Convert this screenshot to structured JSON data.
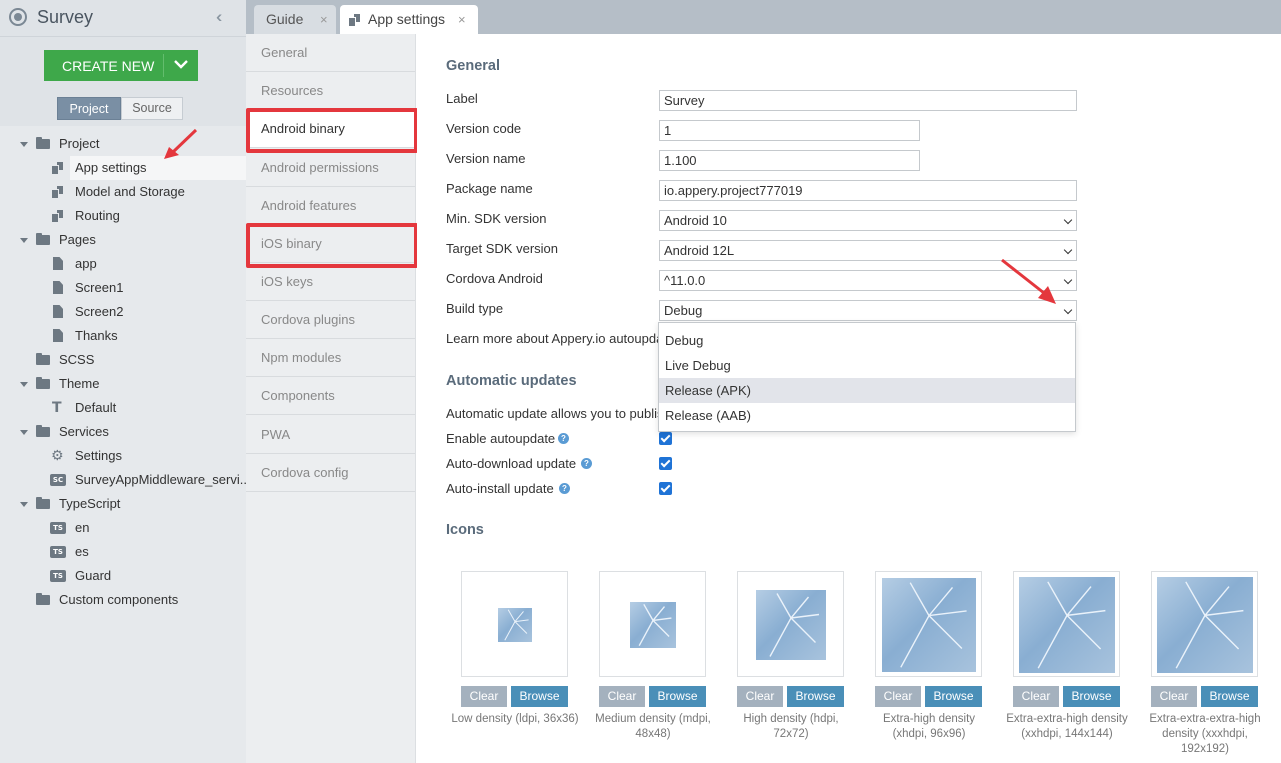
{
  "app": {
    "title": "Survey"
  },
  "create_new": {
    "label": "CREATE NEW"
  },
  "segments": {
    "project": "Project",
    "source": "Source"
  },
  "tree": {
    "project": "Project",
    "app_settings": "App settings",
    "model_storage": "Model and Storage",
    "routing": "Routing",
    "pages": "Pages",
    "app": "app",
    "screen1": "Screen1",
    "screen2": "Screen2",
    "thanks": "Thanks",
    "scss": "SCSS",
    "theme": "Theme",
    "default": "Default",
    "services": "Services",
    "settings": "Settings",
    "middleware": "SurveyAppMiddleware_servi...",
    "typescript": "TypeScript",
    "en": "en",
    "es": "es",
    "guard": "Guard",
    "custom_components": "Custom components",
    "badge_sc": "SC",
    "badge_ts": "TS"
  },
  "tabs": {
    "guide": "Guide",
    "app_settings": "App settings",
    "close": "×"
  },
  "nav": [
    "General",
    "Resources",
    "Android binary",
    "Android permissions",
    "Android features",
    "iOS binary",
    "iOS keys",
    "Cordova plugins",
    "Npm modules",
    "Components",
    "PWA",
    "Cordova config"
  ],
  "general": {
    "title": "General",
    "label_label": "Label",
    "label_value": "Survey",
    "version_code_label": "Version code",
    "version_code_value": "1",
    "version_name_label": "Version name",
    "version_name_value": "1.100",
    "package_label": "Package name",
    "package_value": "io.appery.project777019",
    "min_sdk_label": "Min. SDK version",
    "min_sdk_value": "Android 10",
    "target_sdk_label": "Target SDK version",
    "target_sdk_value": "Android 12L",
    "cordova_label": "Cordova Android",
    "cordova_value": "^11.0.0",
    "build_type_label": "Build type",
    "build_type_value": "Debug",
    "learn_more": "Learn more about Appery.io autoupda"
  },
  "build_type_options": [
    "Debug",
    "Live Debug",
    "Release (APK)",
    "Release (AAB)"
  ],
  "auto": {
    "title": "Automatic updates",
    "desc": "Automatic update allows you to publis",
    "enable": "Enable autoupdate",
    "download": "Auto-download update",
    "install": "Auto-install update",
    "help": "?"
  },
  "icons": {
    "title": "Icons",
    "clear": "Clear",
    "browse": "Browse",
    "captions": [
      "Low density (ldpi, 36x36)",
      "Medium density (mdpi, 48x48)",
      "High density (hdpi, 72x72)",
      "Extra-high density (xhdpi, 96x96)",
      "Extra-extra-high density (xxhdpi, 144x144)",
      "Extra-extra-extra-high density (xxxhdpi, 192x192)"
    ]
  },
  "colors": {
    "accent_green": "#3ea84a",
    "highlight_red": "#e4373d",
    "checkbox_blue": "#1f73d6"
  }
}
